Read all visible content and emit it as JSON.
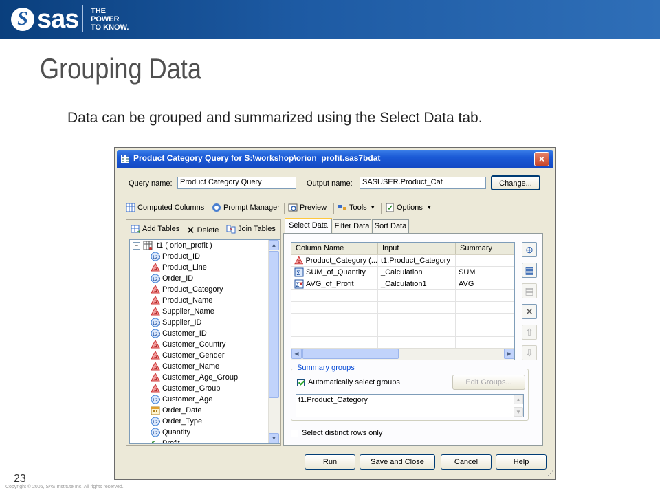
{
  "brand": {
    "logo": "sas",
    "tagline": [
      "THE",
      "POWER",
      "TO KNOW."
    ]
  },
  "slide": {
    "title": "Grouping Data",
    "body": "Data can be grouped and summarized using the Select Data tab.",
    "number": "23",
    "copyright": "Copyright © 2006, SAS Institute Inc. All rights reserved."
  },
  "dialog": {
    "title": "Product Category Query for S:\\workshop\\orion_profit.sas7bdat",
    "close_label": "×",
    "query_name_label": "Query name:",
    "query_name_value": "Product Category Query",
    "output_name_label": "Output name:",
    "output_name_value": "SASUSER.Product_Cat",
    "change_button": "Change...",
    "toolbar": [
      {
        "label": "Computed Columns",
        "icon": "computed-columns-icon"
      },
      {
        "label": "Prompt Manager",
        "icon": "prompt-manager-icon"
      },
      {
        "label": "Preview",
        "icon": "preview-icon"
      },
      {
        "label": "Tools",
        "icon": "tools-icon"
      },
      {
        "label": "Options",
        "icon": "options-icon"
      }
    ],
    "left_toolbar": {
      "add_tables": "Add Tables",
      "delete": "Delete",
      "join_tables": "Join Tables"
    },
    "tree": {
      "root": "t1 ( orion_profit )",
      "columns": [
        {
          "name": "Product_ID",
          "type": "numeric"
        },
        {
          "name": "Product_Line",
          "type": "character"
        },
        {
          "name": "Order_ID",
          "type": "numeric"
        },
        {
          "name": "Product_Category",
          "type": "character"
        },
        {
          "name": "Product_Name",
          "type": "character"
        },
        {
          "name": "Supplier_Name",
          "type": "character"
        },
        {
          "name": "Supplier_ID",
          "type": "numeric"
        },
        {
          "name": "Customer_ID",
          "type": "numeric"
        },
        {
          "name": "Customer_Country",
          "type": "character"
        },
        {
          "name": "Customer_Gender",
          "type": "character"
        },
        {
          "name": "Customer_Name",
          "type": "character"
        },
        {
          "name": "Customer_Age_Group",
          "type": "character"
        },
        {
          "name": "Customer_Group",
          "type": "character"
        },
        {
          "name": "Customer_Age",
          "type": "numeric"
        },
        {
          "name": "Order_Date",
          "type": "date"
        },
        {
          "name": "Order_Type",
          "type": "numeric"
        },
        {
          "name": "Quantity",
          "type": "numeric"
        },
        {
          "name": "Profit",
          "type": "currency"
        }
      ]
    },
    "tabs": [
      "Select Data",
      "Filter Data",
      "Sort Data"
    ],
    "active_tab": "Select Data",
    "grid": {
      "headers": [
        "Column Name",
        "Input",
        "Summary"
      ],
      "rows": [
        {
          "name": "Product_Category (...",
          "input": "t1.Product_Category",
          "summary": "",
          "icon": "character"
        },
        {
          "name": "SUM_of_Quantity",
          "input": "_Calculation",
          "summary": "SUM",
          "icon": "calc"
        },
        {
          "name": "AVG_of_Profit",
          "input": "_Calculation1",
          "summary": "AVG",
          "icon": "calc-x"
        }
      ]
    },
    "summary_groups": {
      "legend": "Summary groups",
      "auto_select_label": "Automatically select groups",
      "auto_select_checked": true,
      "edit_groups_button": "Edit Groups...",
      "groups": [
        "t1.Product_Category"
      ]
    },
    "distinct_rows_label": "Select distinct rows only",
    "distinct_rows_checked": false,
    "buttons": {
      "run": "Run",
      "save_close": "Save and Close",
      "cancel": "Cancel",
      "help": "Help"
    },
    "colors": {
      "titlebar": "#1b5ad6",
      "dialog_bg": "#ece9d8",
      "char_icon": "#e04040",
      "num_icon": "#3b7fd8"
    }
  }
}
